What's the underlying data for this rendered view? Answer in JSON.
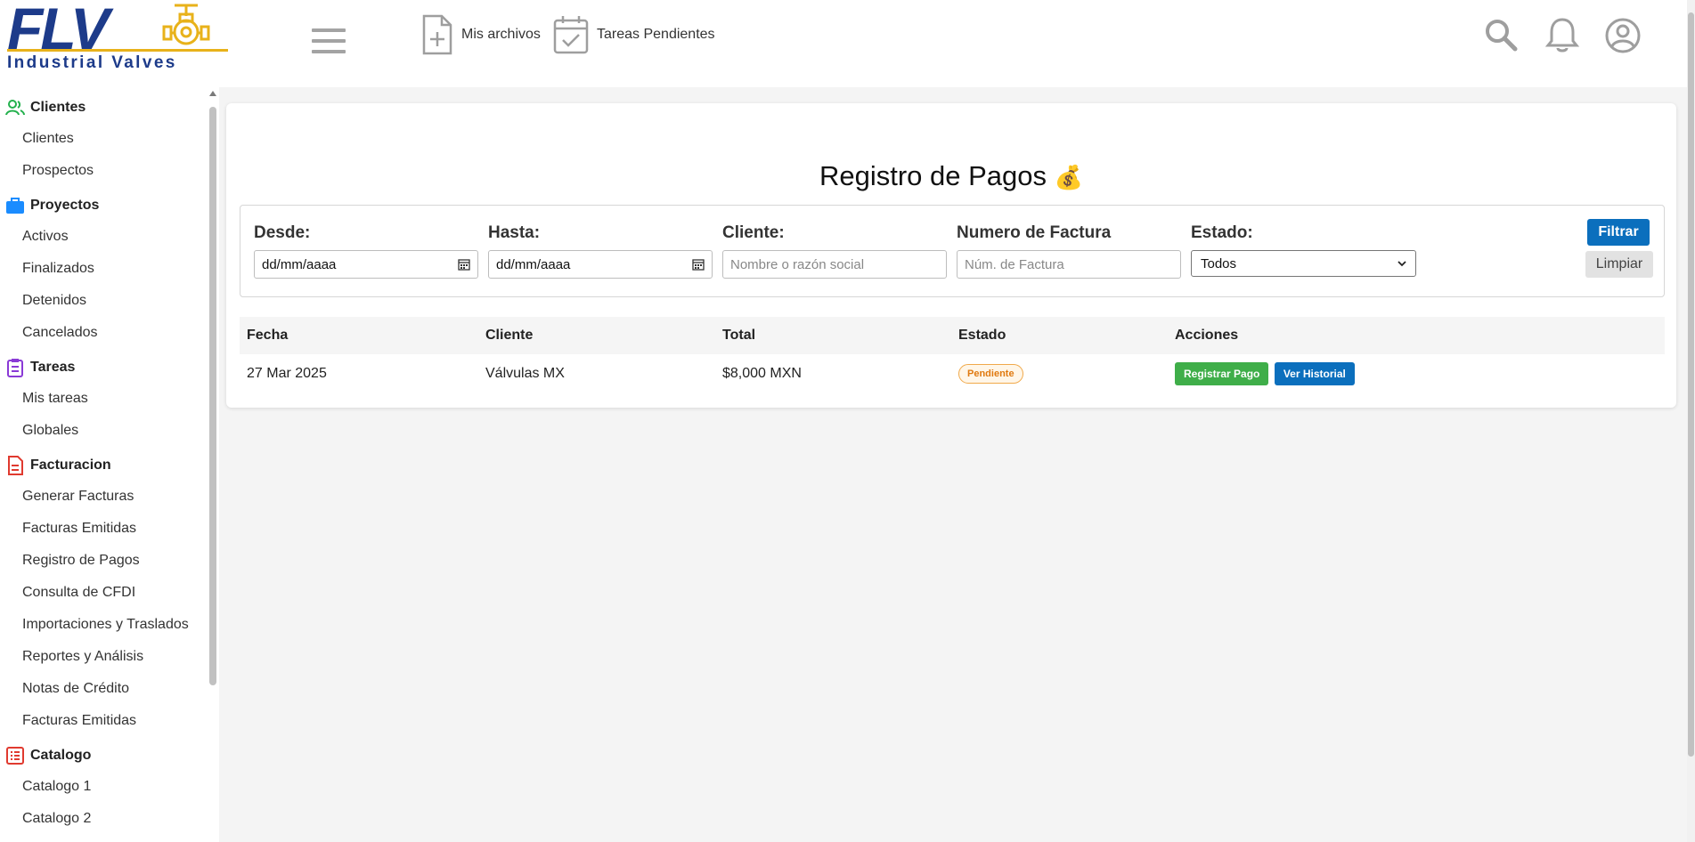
{
  "logo": {
    "main": "FLV",
    "tagline": "Industrial Valves"
  },
  "header": {
    "links": [
      {
        "label": "Mis archivos",
        "icon": "file-plus-icon"
      },
      {
        "label": "Tareas Pendientes",
        "icon": "calendar-check-icon"
      }
    ],
    "icons": [
      "search-icon",
      "bell-icon",
      "user-circle-icon"
    ]
  },
  "sidebar": {
    "sections": [
      {
        "title": "Clientes",
        "icon": "users-icon",
        "color": "#22b04c",
        "items": [
          "Clientes",
          "Prospectos"
        ]
      },
      {
        "title": "Proyectos",
        "icon": "briefcase-icon",
        "color": "#1a8cff",
        "items": [
          "Activos",
          "Finalizados",
          "Detenidos",
          "Cancelados"
        ]
      },
      {
        "title": "Tareas",
        "icon": "clipboard-icon",
        "color": "#8a3ad6",
        "items": [
          "Mis tareas",
          "Globales"
        ]
      },
      {
        "title": "Facturacion",
        "icon": "document-icon",
        "color": "#e03a2f",
        "items": [
          "Generar Facturas",
          "Facturas Emitidas",
          "Registro de Pagos",
          "Consulta de CFDI",
          "Importaciones y Traslados",
          "Reportes y Análisis",
          "Notas de Crédito",
          "Facturas Emitidas"
        ]
      },
      {
        "title": "Catalogo",
        "icon": "list-icon",
        "color": "#e03a2f",
        "items": [
          "Catalogo 1",
          "Catalogo 2"
        ]
      }
    ]
  },
  "main": {
    "title": "Registro de Pagos",
    "title_emoji": "💰",
    "filters": {
      "desde": {
        "label": "Desde:",
        "value": "dd/mm/aaaa"
      },
      "hasta": {
        "label": "Hasta:",
        "value": "dd/mm/aaaa"
      },
      "cliente": {
        "label": "Cliente:",
        "placeholder": "Nombre o razón social"
      },
      "factura": {
        "label": "Numero de Factura",
        "placeholder": "Núm. de Factura"
      },
      "estado": {
        "label": "Estado:",
        "value": "Todos"
      },
      "filtrar": "Filtrar",
      "limpiar": "Limpiar"
    },
    "table": {
      "headers": [
        "Fecha",
        "Cliente",
        "Total",
        "Estado",
        "Acciones"
      ],
      "rows": [
        {
          "fecha": "27 Mar 2025",
          "cliente": "Válvulas MX",
          "total": "$8,000 MXN",
          "estado": "Pendiente",
          "actions": [
            "Registrar Pago",
            "Ver Historial"
          ]
        }
      ]
    }
  },
  "colors": {
    "primary": "#0b6fbd",
    "success": "#3fae49",
    "warning": "#e07a10",
    "brand": "#1d3b8a",
    "accent": "#e8b21a"
  }
}
